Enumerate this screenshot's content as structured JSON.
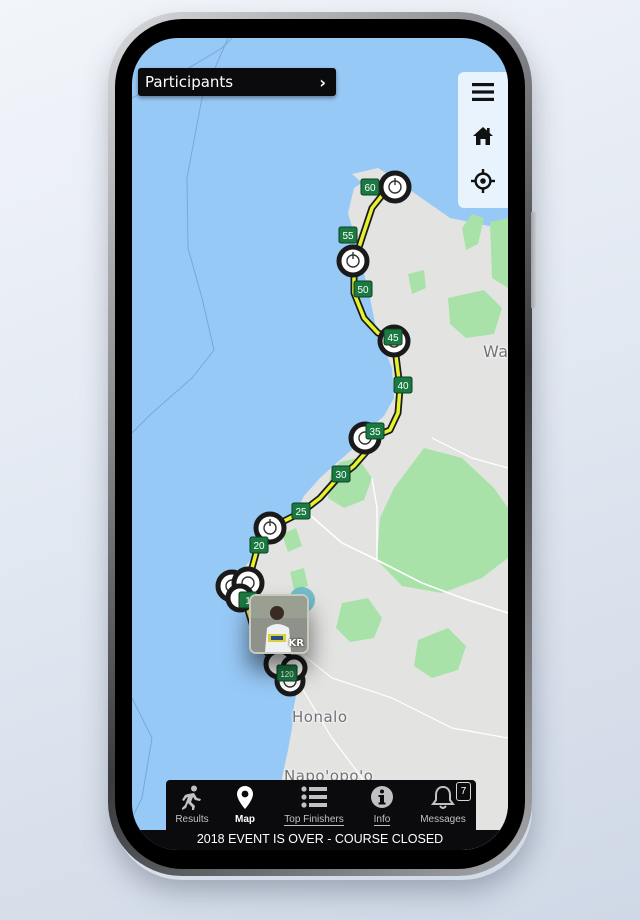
{
  "header": {
    "participants_label": "Participants",
    "chevron": "›"
  },
  "map_controls": [
    "menu-icon",
    "home-icon",
    "locate-crosshair-icon"
  ],
  "map": {
    "place_labels": [
      "Honalo",
      "Napo'opo'o",
      "Wa"
    ],
    "mile_markers": [
      "20",
      "25",
      "30",
      "35",
      "40",
      "45",
      "50",
      "55",
      "60",
      "1",
      "120"
    ],
    "runner_initials": "KR"
  },
  "colors": {
    "water": "#97c9f7",
    "land": "#e3e4e1",
    "park": "#a8e2a9",
    "route": "#e6f22e",
    "marker": "#1b7a42"
  },
  "nav": {
    "items": [
      {
        "label": "Results",
        "icon": "runner-icon"
      },
      {
        "label": "Map",
        "icon": "map-pin-icon"
      },
      {
        "label": "Top Finishers",
        "icon": "list-icon"
      },
      {
        "label": "Info",
        "icon": "info-icon"
      },
      {
        "label": "Messages",
        "icon": "bell-icon",
        "badge": "7"
      }
    ]
  },
  "status": "2018 EVENT IS OVER - COURSE CLOSED"
}
